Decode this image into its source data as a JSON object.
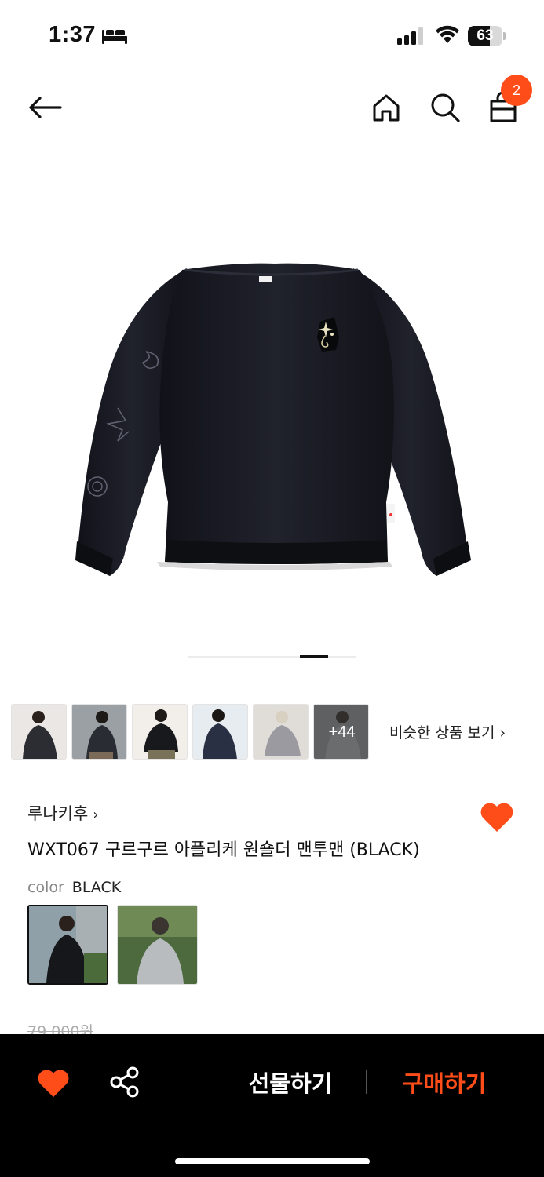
{
  "status_bar": {
    "time": "1:37",
    "battery_percent": "63",
    "battery_level": 0.63
  },
  "nav": {
    "cart_count": "2",
    "icons": [
      "back-arrow-icon",
      "home-icon",
      "search-icon",
      "shopping-bag-icon"
    ]
  },
  "gallery": {
    "page_count": 6,
    "current_page": 4,
    "more_count_label": "+44",
    "similar_label": "비슷한 상품 보기",
    "similar_chevron": "›"
  },
  "product": {
    "brand": "루나키후",
    "brand_chevron": "›",
    "title": "WXT067 구르구르 아플리케 원숄더 맨투맨 (BLACK)",
    "liked": true,
    "color_label": "color",
    "color_value": "BLACK",
    "original_price": "79,000원"
  },
  "bottom_bar": {
    "gift_label": "선물하기",
    "buy_label": "구매하기"
  },
  "colors": {
    "accent": "#ff4d1a",
    "bottom_bar_bg": "#000000"
  }
}
